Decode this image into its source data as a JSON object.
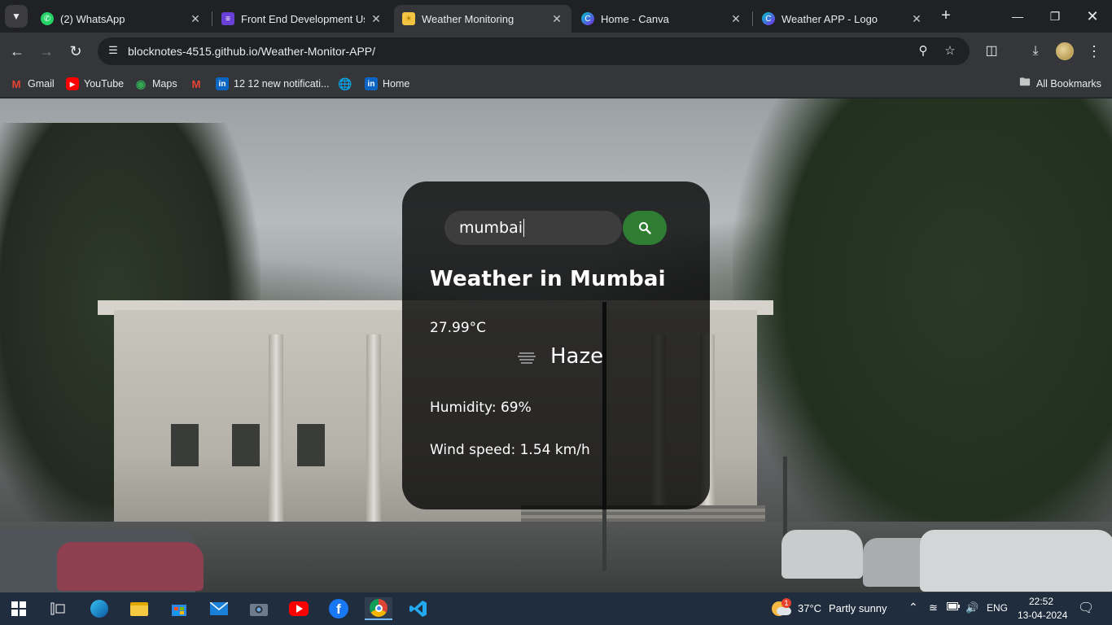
{
  "browser": {
    "tabs": [
      {
        "title": "(2) WhatsApp",
        "icon": "whatsapp-icon",
        "color": "#25d366"
      },
      {
        "title": "Front End Development Usin",
        "icon": "list-icon",
        "color": "#6a3fd6"
      },
      {
        "title": "Weather Monitoring",
        "icon": "sun-icon",
        "color": "#f4c542"
      },
      {
        "title": "Home - Canva",
        "icon": "canva-icon",
        "color": "#7d2ae8"
      },
      {
        "title": "Weather APP - Logo",
        "icon": "canva-icon",
        "color": "#7d2ae8"
      }
    ],
    "active_tab": "Weather Monitoring",
    "url": "blocknotes-4515.github.io/Weather-Monitor-APP/",
    "bookmarks": [
      {
        "label": "Gmail",
        "icon": "gmail-icon"
      },
      {
        "label": "YouTube",
        "icon": "youtube-icon"
      },
      {
        "label": "Maps",
        "icon": "maps-icon"
      },
      {
        "label": "",
        "icon": "gmail-icon"
      },
      {
        "label": "12 12 new notificati...",
        "icon": "linkedin-icon"
      },
      {
        "label": "",
        "icon": "globe-icon"
      },
      {
        "label": "Home",
        "icon": "linkedin-icon"
      }
    ],
    "all_bookmarks_label": "All Bookmarks"
  },
  "weather": {
    "search_value": "mumbai",
    "heading": "Weather in Mumbai",
    "temperature": "27.99°C",
    "condition": "Haze",
    "humidity": "Humidity: 69%",
    "wind": "Wind speed: 1.54 km/h",
    "button_color": "#2e7d32"
  },
  "taskbar": {
    "weather_temp": "37°C",
    "weather_desc": "Partly sunny",
    "language": "ENG",
    "time": "22:52",
    "date": "13-04-2024",
    "weather_badge": "1"
  }
}
